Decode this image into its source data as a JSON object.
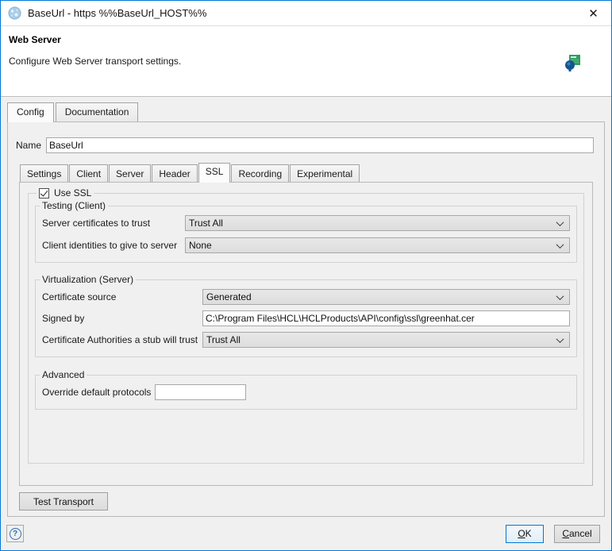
{
  "window": {
    "title": "BaseUrl - https %%BaseUrl_HOST%%",
    "close_icon": "✕"
  },
  "header": {
    "title": "Web Server",
    "subtitle": "Configure Web Server transport settings."
  },
  "outer_tabs": [
    {
      "label": "Config",
      "active": true
    },
    {
      "label": "Documentation",
      "active": false
    }
  ],
  "form": {
    "name": {
      "label": "Name",
      "value": "BaseUrl"
    }
  },
  "inner_tabs": [
    {
      "label": "Settings",
      "active": false
    },
    {
      "label": "Client",
      "active": false
    },
    {
      "label": "Server",
      "active": false
    },
    {
      "label": "Header",
      "active": false
    },
    {
      "label": "SSL",
      "active": true
    },
    {
      "label": "Recording",
      "active": false
    },
    {
      "label": "Experimental",
      "active": false
    }
  ],
  "ssl": {
    "use_ssl": {
      "label": "Use SSL",
      "checked": true
    },
    "testing": {
      "title": "Testing (Client)",
      "rows": [
        {
          "label": "Server certificates to trust",
          "control": "select",
          "value": "Trust All"
        },
        {
          "label": "Client identities to give to server",
          "control": "select",
          "value": "None"
        }
      ]
    },
    "virtualization": {
      "title": "Virtualization (Server)",
      "rows": [
        {
          "label": "Certificate source",
          "control": "select",
          "value": "Generated"
        },
        {
          "label": "Signed by",
          "control": "text",
          "value": "C:\\Program Files\\HCL\\HCLProducts\\API\\config\\ssl\\greenhat.cer"
        },
        {
          "label": "Certificate Authorities a stub will trust",
          "control": "select",
          "value": "Trust All"
        }
      ]
    },
    "advanced": {
      "title": "Advanced",
      "rows": [
        {
          "label": "Override default protocols",
          "control": "text",
          "value": ""
        }
      ]
    }
  },
  "footer": {
    "test_transport": "Test Transport",
    "help": "?",
    "ok": "OK",
    "cancel": "Cancel"
  },
  "icons": {
    "app": "globe-icon",
    "header": "web-server-transport-icon",
    "close": "close-icon",
    "help": "help-icon",
    "combo": "chevron-down-icon"
  },
  "colors": {
    "accent": "#0078d7",
    "dialog_bg": "#f0f0f0",
    "titlebar_bg": "#ffffff",
    "field_border": "#a8a8a8"
  }
}
